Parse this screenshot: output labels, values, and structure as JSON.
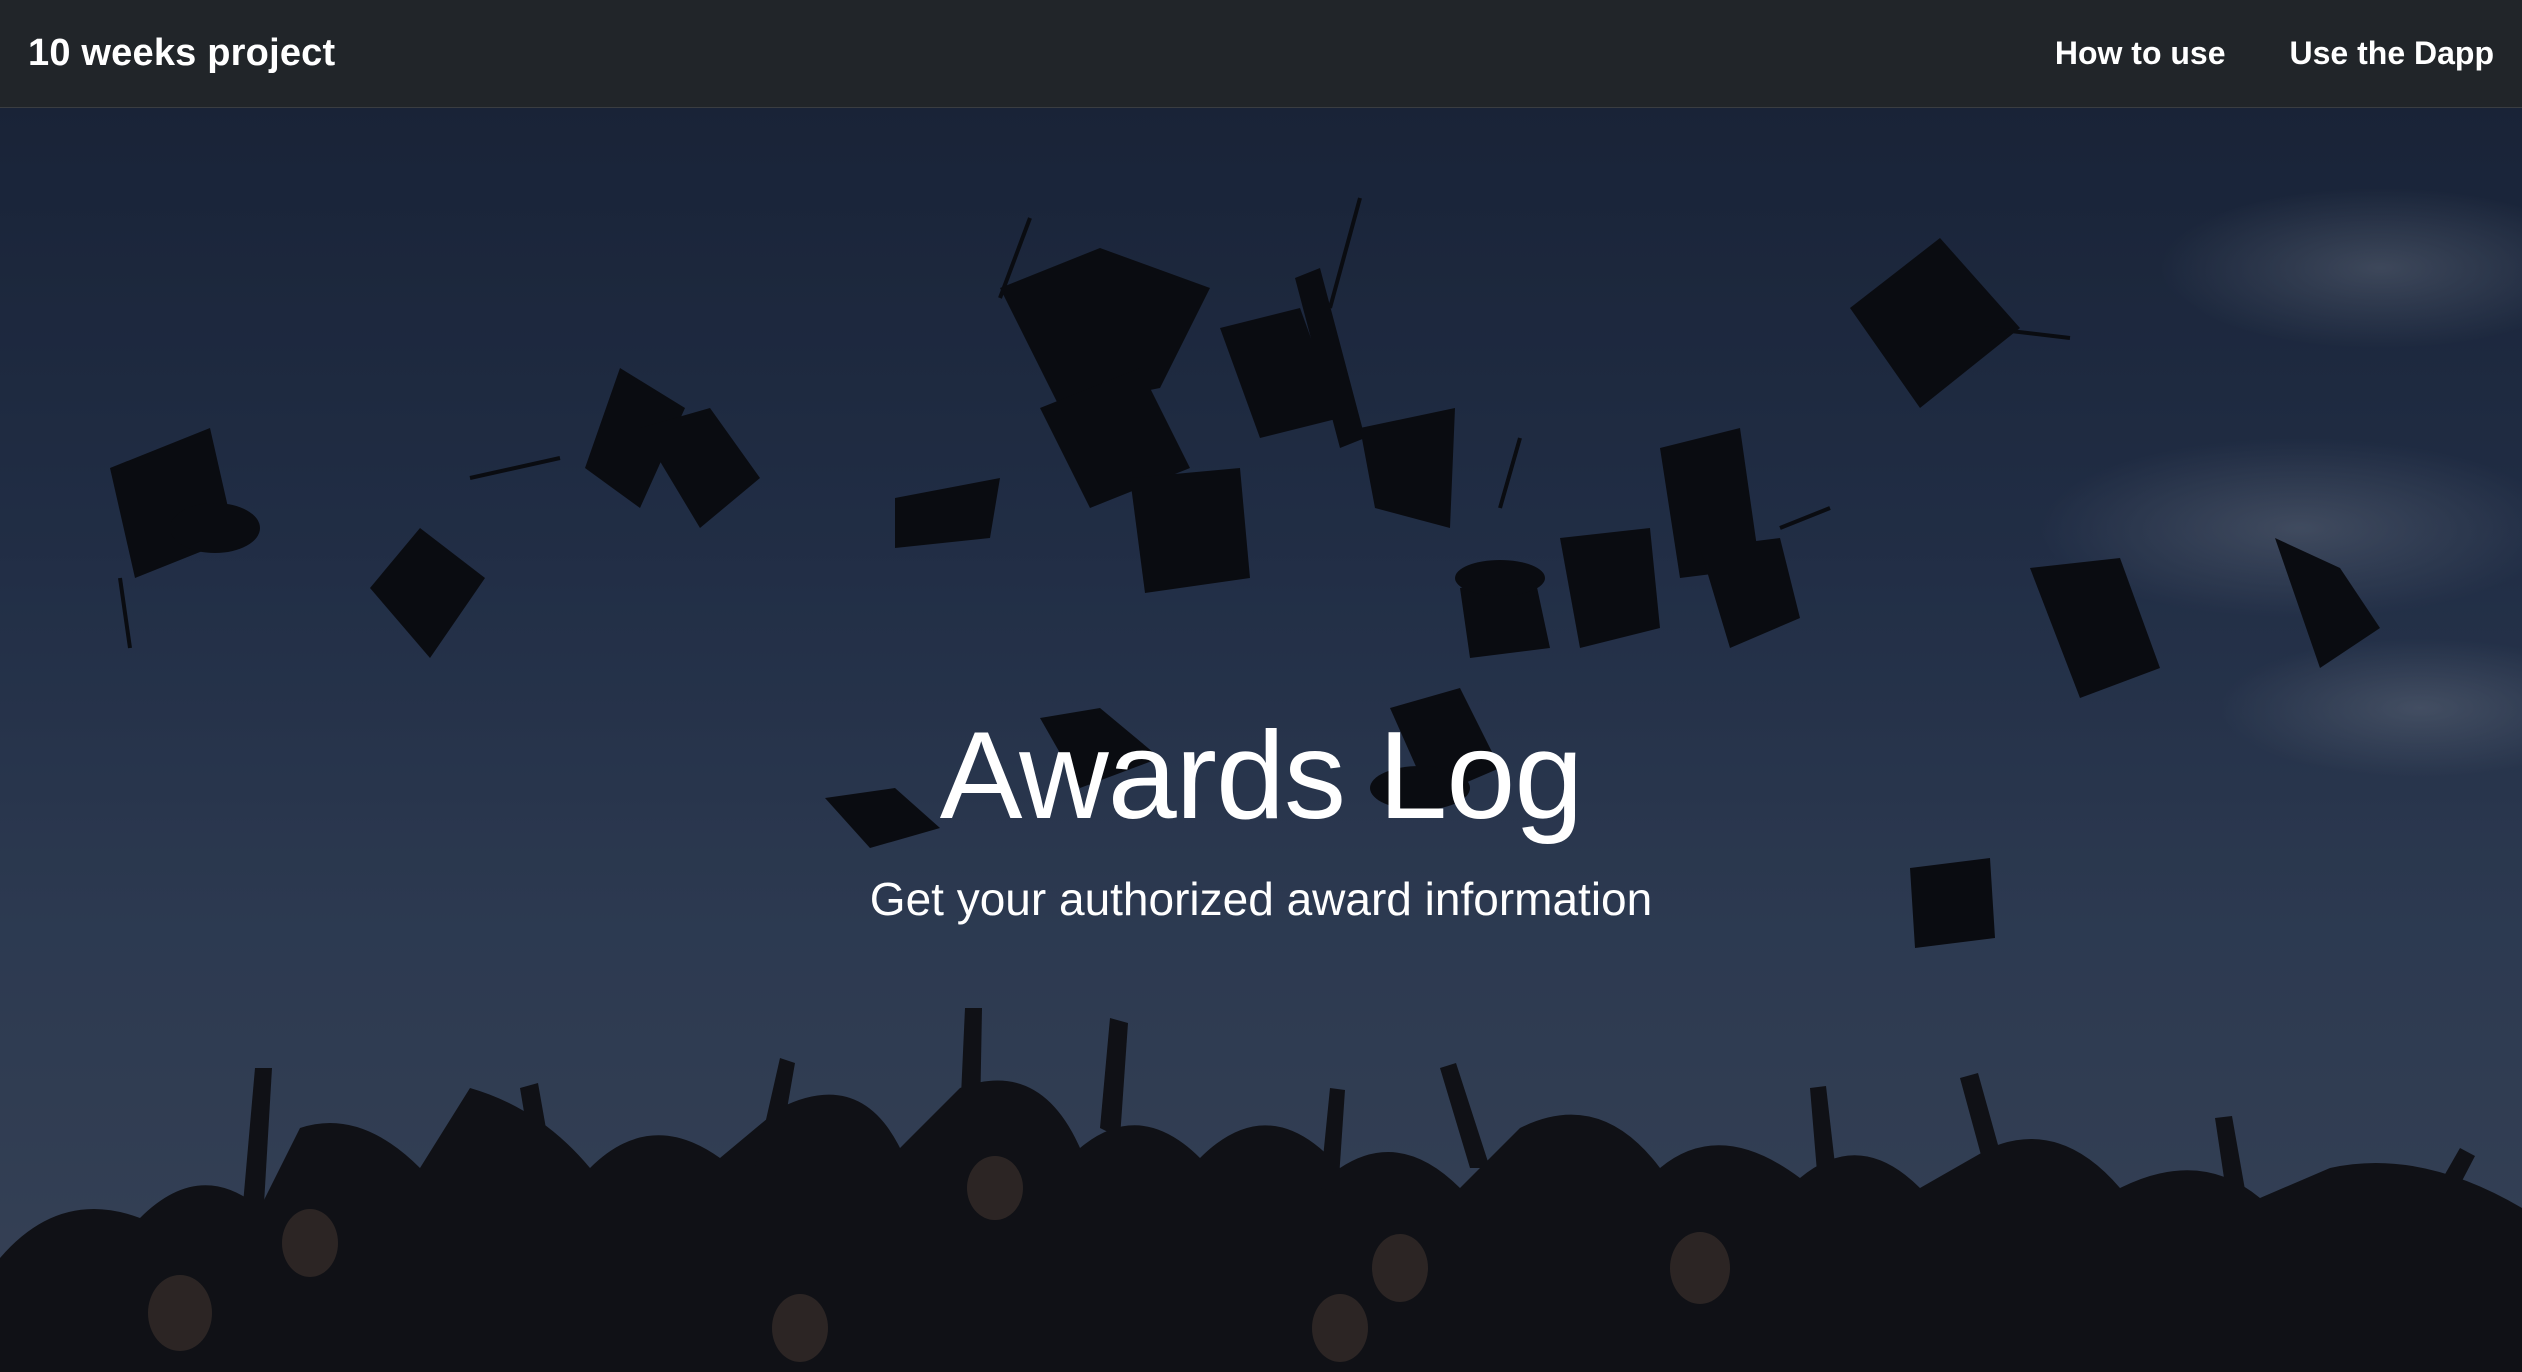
{
  "navbar": {
    "brand": "10 weeks project",
    "links": [
      {
        "label": "How to use"
      },
      {
        "label": "Use the Dapp"
      }
    ]
  },
  "hero": {
    "title": "Awards Log",
    "subtitle": "Get your authorized award information",
    "background_image": "graduation-caps-thrown-in-sky",
    "colors": {
      "sky_top": "#1f2c45",
      "sky_bottom": "#48566e",
      "cap": "#0b0c10",
      "crowd": "#121317"
    }
  }
}
